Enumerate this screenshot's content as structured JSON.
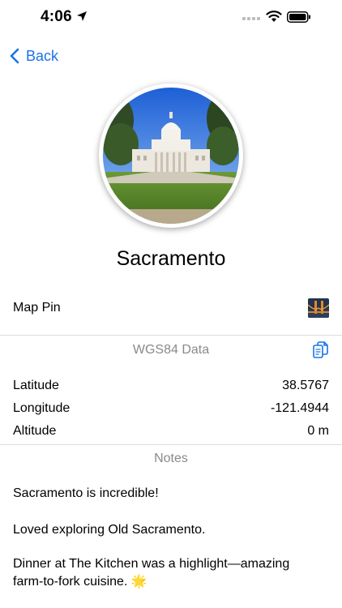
{
  "status_bar": {
    "time": "4:06"
  },
  "nav": {
    "back_label": "Back"
  },
  "place": {
    "title": "Sacramento"
  },
  "map_pin": {
    "label": "Map Pin"
  },
  "wgs84": {
    "header": "WGS84 Data",
    "rows": [
      {
        "label": "Latitude",
        "value": "38.5767"
      },
      {
        "label": "Longitude",
        "value": "-121.4944"
      },
      {
        "label": "Altitude",
        "value": "0 m"
      }
    ]
  },
  "notes": {
    "header": "Notes",
    "paragraphs": [
      "Sacramento is incredible!",
      "Loved exploring Old Sacramento.",
      "Dinner at The Kitchen was a highlight—amazing farm-to-fork cuisine. 🌟"
    ]
  },
  "icons": {
    "back": "chevron-left-icon",
    "copy": "copy-icon",
    "location": "location-arrow-icon",
    "wifi": "wifi-icon",
    "battery": "battery-icon"
  },
  "colors": {
    "accent": "#1a73e8",
    "section_header": "#8a8a8e",
    "divider": "#dcdcdc"
  }
}
